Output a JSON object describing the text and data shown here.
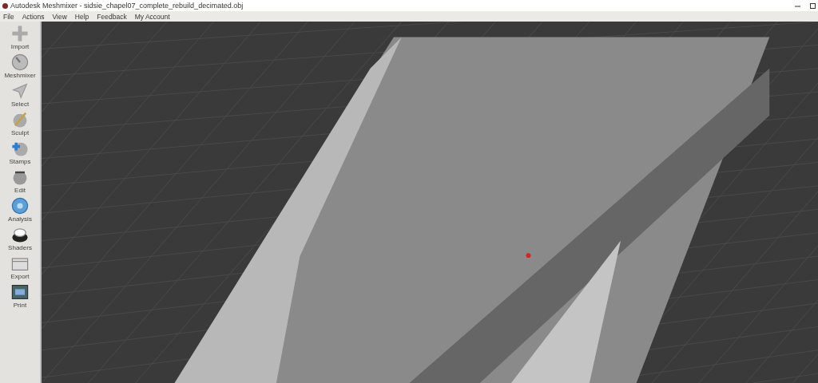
{
  "window": {
    "title": "Autodesk Meshmixer - sidsie_chapel07_complete_rebuild_decimated.obj"
  },
  "menu": [
    "File",
    "Actions",
    "View",
    "Help",
    "Feedback",
    "My Account"
  ],
  "tools": [
    {
      "label": "Import"
    },
    {
      "label": "Meshmixer"
    },
    {
      "label": "Select"
    },
    {
      "label": "Sculpt"
    },
    {
      "label": "Stamps"
    },
    {
      "label": "Edit"
    },
    {
      "label": "Analysis"
    },
    {
      "label": "Shaders"
    },
    {
      "label": "Export"
    },
    {
      "label": "Print"
    }
  ]
}
